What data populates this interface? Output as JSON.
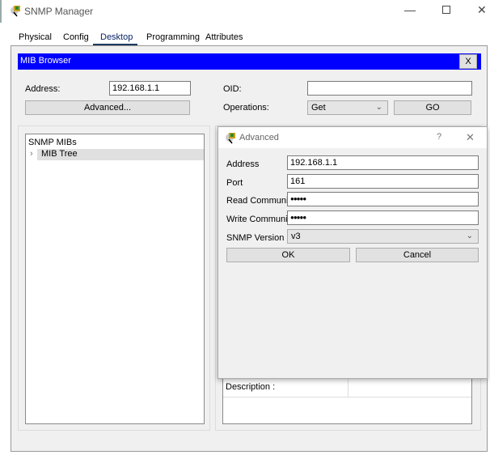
{
  "window": {
    "title": "SNMP Manager",
    "icon": "snmp-manager-icon"
  },
  "tabs": [
    {
      "label": "Physical",
      "active": false
    },
    {
      "label": "Config",
      "active": false
    },
    {
      "label": "Desktop",
      "active": true
    },
    {
      "label": "Programming",
      "active": false
    },
    {
      "label": "Attributes",
      "active": false
    }
  ],
  "mib_browser": {
    "title": "MIB Browser",
    "close_label": "X",
    "accent": "#0000ff",
    "address_label": "Address:",
    "address_value": "192.168.1.1",
    "oid_label": "OID:",
    "oid_value": "",
    "advanced_button": "Advanced...",
    "operations_label": "Operations:",
    "operation_selected": "Get",
    "go_button": "GO",
    "tree_root": "SNMP MIBs",
    "tree_item": "MIB Tree",
    "description_label": "Description :"
  },
  "advanced_dialog": {
    "title": "Advanced",
    "help": "?",
    "close": "✕",
    "address_label": "Address",
    "address_value": "192.168.1.1",
    "port_label": "Port",
    "port_value": "161",
    "read_label": "Read Community",
    "read_value": "●●●●●",
    "write_label": "Write Community",
    "write_value": "●●●●●",
    "version_label": "SNMP Version",
    "version_value": "v3",
    "ok_button": "OK",
    "cancel_button": "Cancel"
  }
}
